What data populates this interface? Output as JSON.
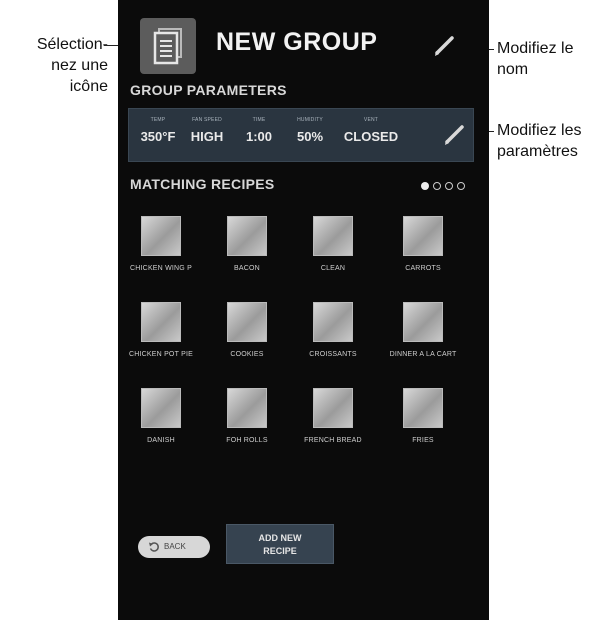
{
  "annotations": {
    "select_icon": [
      "Sélection-",
      "nez une",
      "icône"
    ],
    "edit_name": [
      "Modifiez le",
      "nom"
    ],
    "edit_params": [
      "Modifiez les",
      "paramètres"
    ]
  },
  "header": {
    "title": "NEW GROUP",
    "icon": "document-icon",
    "edit_icon": "pencil-icon"
  },
  "group_parameters": {
    "title": "GROUP PARAMETERS",
    "items": [
      {
        "label": "TEMP",
        "value": "350°F"
      },
      {
        "label": "FAN SPEED",
        "value": "HIGH"
      },
      {
        "label": "TIME",
        "value": "1:00"
      },
      {
        "label": "HUMIDITY",
        "value": "50%"
      },
      {
        "label": "VENT",
        "value": "CLOSED"
      }
    ]
  },
  "matching_recipes": {
    "title": "MATCHING RECIPES",
    "page_count": 4,
    "active_page": 1,
    "items": [
      "CHICKEN WING P",
      "BACON",
      "CLEAN",
      "CARROTS",
      "CHICKEN POT PIE",
      "COOKIES",
      "CROISSANTS",
      "DINNER A LA CART",
      "DANISH",
      "FOH ROLLS",
      "FRENCH BREAD",
      "FRIES"
    ]
  },
  "footer": {
    "back_label": "BACK",
    "add_label_line1": "ADD NEW",
    "add_label_line2": "RECIPE"
  },
  "colors": {
    "screen_bg": "#0b0b0b",
    "panel_bg": "#2a3540",
    "button_bg": "#364350"
  }
}
